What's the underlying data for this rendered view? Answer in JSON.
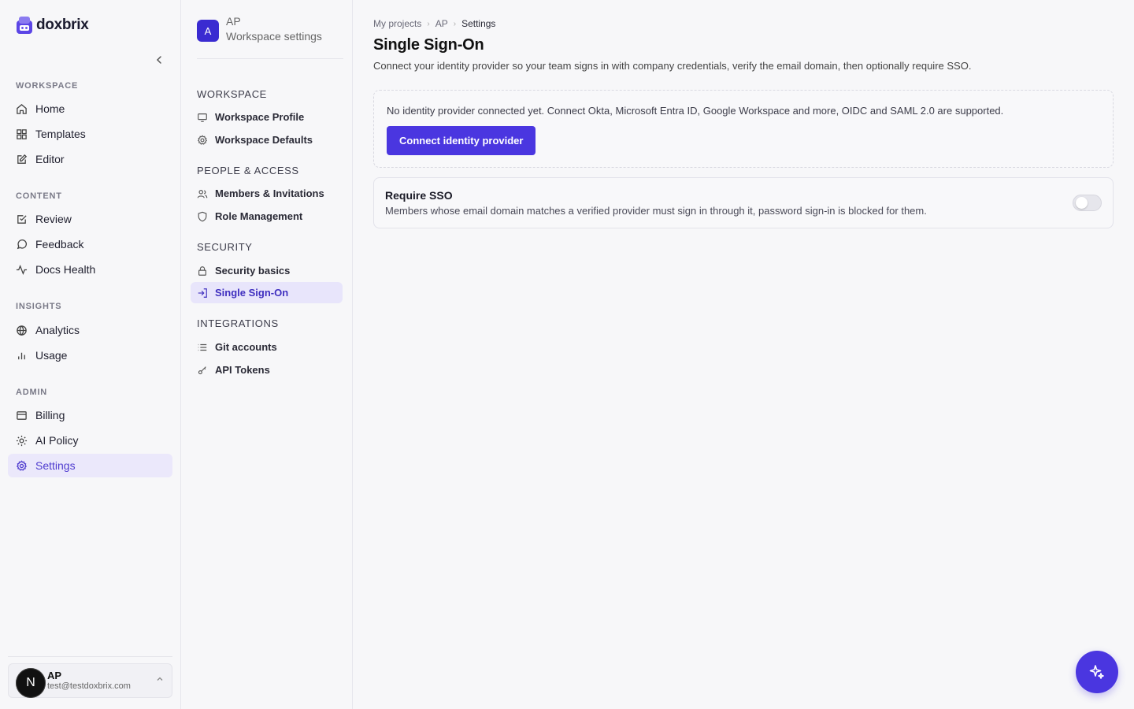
{
  "brand": {
    "name": "doxbrix",
    "accent": "#4a36e0"
  },
  "sidebar": {
    "sections": [
      {
        "title": "WORKSPACE",
        "items": [
          {
            "label": "Home",
            "icon": "home-icon"
          },
          {
            "label": "Templates",
            "icon": "grid-icon"
          },
          {
            "label": "Editor",
            "icon": "edit-icon"
          }
        ]
      },
      {
        "title": "CONTENT",
        "items": [
          {
            "label": "Review",
            "icon": "check-square-icon"
          },
          {
            "label": "Feedback",
            "icon": "message-circle-icon"
          },
          {
            "label": "Docs Health",
            "icon": "activity-icon"
          }
        ]
      },
      {
        "title": "INSIGHTS",
        "items": [
          {
            "label": "Analytics",
            "icon": "globe-icon"
          },
          {
            "label": "Usage",
            "icon": "bar-chart-icon"
          }
        ]
      },
      {
        "title": "ADMIN",
        "items": [
          {
            "label": "Billing",
            "icon": "credit-card-icon"
          },
          {
            "label": "AI Policy",
            "icon": "sun-icon"
          },
          {
            "label": "Settings",
            "icon": "settings-icon",
            "active": true
          }
        ]
      }
    ],
    "user": {
      "initial": "N",
      "name": "AP",
      "email": "test@testdoxbrix.com"
    }
  },
  "panel": {
    "workspace_badge": "A",
    "workspace_name": "AP",
    "workspace_subtitle": "Workspace settings",
    "sections": [
      {
        "title": "WORKSPACE",
        "items": [
          {
            "label": "Workspace Profile",
            "icon": "monitor-icon"
          },
          {
            "label": "Workspace Defaults",
            "icon": "gear-icon"
          }
        ]
      },
      {
        "title": "PEOPLE & ACCESS",
        "items": [
          {
            "label": "Members & Invitations",
            "icon": "users-icon"
          },
          {
            "label": "Role Management",
            "icon": "shield-icon"
          }
        ]
      },
      {
        "title": "SECURITY",
        "items": [
          {
            "label": "Security basics",
            "icon": "lock-icon"
          },
          {
            "label": "Single Sign-On",
            "icon": "log-in-icon",
            "active": true
          }
        ]
      },
      {
        "title": "INTEGRATIONS",
        "items": [
          {
            "label": "Git accounts",
            "icon": "list-icon"
          },
          {
            "label": "API Tokens",
            "icon": "key-icon"
          }
        ]
      }
    ]
  },
  "main": {
    "breadcrumb": [
      "My projects",
      "AP",
      "Settings"
    ],
    "title": "Single Sign-On",
    "description": "Connect your identity provider so your team signs in with company credentials, verify the email domain, then optionally require SSO.",
    "idp_card": {
      "text": "No identity provider connected yet. Connect Okta, Microsoft Entra ID, Google Workspace and more, OIDC and SAML 2.0 are supported.",
      "button_label": "Connect identity provider"
    },
    "sso_card": {
      "title": "Require SSO",
      "description": "Members whose email domain matches a verified provider must sign in through it, password sign-in is blocked for them.",
      "enabled": false
    }
  }
}
